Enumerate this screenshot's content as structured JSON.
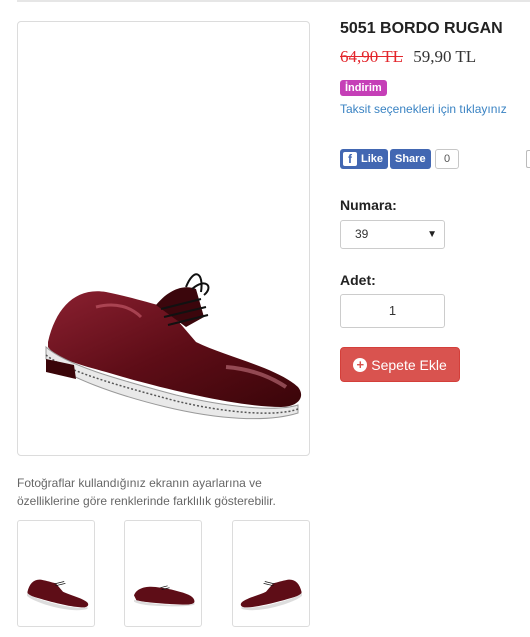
{
  "product": {
    "title": "5051 BORDO RUGAN",
    "old_price": "64,90 TL",
    "new_price": "59,90 TL",
    "badge": "İndirim",
    "installment_link": "Taksit seçenekleri için tıklayınız"
  },
  "social": {
    "like_label": "Like",
    "share_label": "Share",
    "share_count": "0"
  },
  "options": {
    "size_label": "Numara:",
    "size_selected": "39",
    "qty_label": "Adet:",
    "qty_value": "1"
  },
  "cart": {
    "button_label": "Sepete Ekle"
  },
  "disclaimer": "Fotoğraflar kullandığınız ekranın ayarlarına ve özelliklerine göre renklerinde farklılık gösterebilir.",
  "colors": {
    "shoe": "#5e0d17",
    "old_price": "#e3262c",
    "badge": "#c53fb7",
    "link": "#3a83c3",
    "facebook": "#4267b2",
    "cart_button": "#d9534f"
  },
  "icons": {
    "facebook": "facebook-icon",
    "cart_plus": "plus-circle-icon",
    "select_caret": "caret-down-icon"
  }
}
